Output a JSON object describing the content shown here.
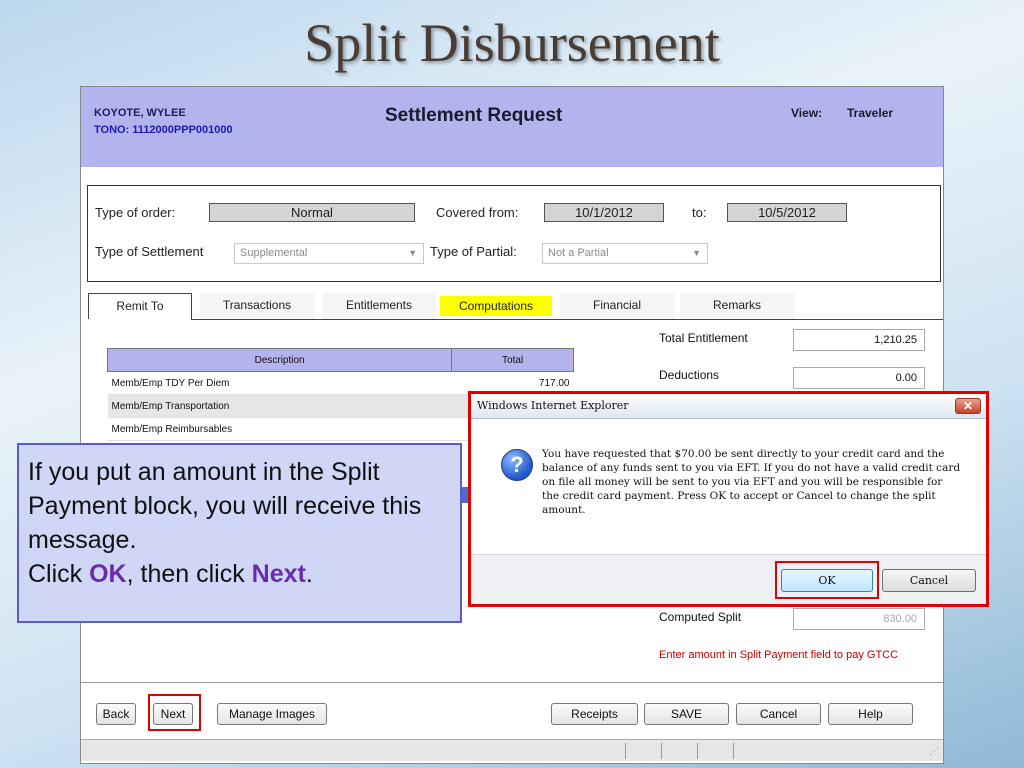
{
  "slide": {
    "title": "Split Disbursement"
  },
  "header": {
    "traveler_name": "KOYOTE, WYLEE",
    "tono": "TONO: 1112000PPP001000",
    "title": "Settlement Request",
    "view_label": "View:",
    "view_value": "Traveler"
  },
  "order": {
    "type_of_order_label": "Type of order:",
    "type_of_order_value": "Normal",
    "covered_from_label": "Covered from:",
    "covered_from_value": "10/1/2012",
    "to_label": "to:",
    "to_value": "10/5/2012",
    "type_of_settlement_label": "Type of Settlement",
    "type_of_settlement_value": "Supplemental",
    "type_of_partial_label": "Type of Partial:",
    "type_of_partial_value": "Not a Partial"
  },
  "tabs": [
    {
      "label": "Remit To"
    },
    {
      "label": "Transactions"
    },
    {
      "label": "Entitlements"
    },
    {
      "label": "Computations"
    },
    {
      "label": "Financial"
    },
    {
      "label": "Remarks"
    }
  ],
  "table": {
    "headers": {
      "description": "Description",
      "total": "Total"
    },
    "rows": [
      {
        "description": "Memb/Emp TDY Per Diem",
        "total": "717.00"
      },
      {
        "description": "Memb/Emp Transportation",
        "total": ""
      },
      {
        "description": "Memb/Emp Reimbursables",
        "total": ""
      }
    ]
  },
  "computations": {
    "total_entitlement_label": "Total Entitlement",
    "total_entitlement_value": "1,210.25",
    "deductions_label": "Deductions",
    "deductions_value": "0.00",
    "computed_split_label": "Computed Split",
    "computed_split_value": "830.00",
    "split_note": "Enter amount in Split Payment field to pay GTCC"
  },
  "buttons": {
    "back": "Back",
    "next": "Next",
    "manage_images": "Manage Images",
    "receipts": "Receipts",
    "save": "SAVE",
    "cancel": "Cancel",
    "help": "Help"
  },
  "callout": {
    "line1": "If you put an amount in the Split Payment block, you will receive this message.",
    "click": "Click ",
    "ok": "OK",
    "then": ", then click ",
    "next": "Next",
    "period": "."
  },
  "dialog": {
    "title": "Windows Internet Explorer",
    "close": "✕",
    "icon": "?",
    "message": "You have requested that $70.00 be sent directly to your credit card and the balance of any funds sent to you via EFT.  If you do not have a valid credit card on file all money will be sent to you via EFT and you will be responsible for the credit card payment.  Press OK to accept or Cancel to change the split amount.",
    "ok": "OK",
    "cancel": "Cancel"
  },
  "colors": {
    "header_bg": "#b3b3ee",
    "tab_highlight": "#ffff00",
    "highlight_red": "#e00000",
    "callout_emphasis": "#6a2bb0",
    "note_red": "#c00000"
  }
}
